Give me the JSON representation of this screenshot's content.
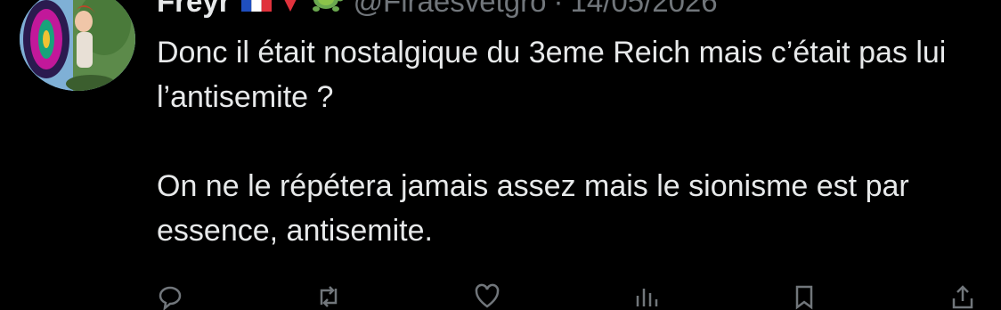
{
  "tweet": {
    "author": {
      "display_name": "Freyr",
      "flag_icon": "france-flag-icon",
      "pin_icon": "red-pin-icon",
      "turtle_icon": "turtle-emoji-icon",
      "handle": "@Firaesvetgro",
      "separator": "·",
      "date": "14/05/2026"
    },
    "text": {
      "paragraph_1": "Donc il était nostalgique du 3eme Reich mais c’était pas lui l’antisemite ?",
      "paragraph_2": "On ne le répétera jamais assez mais le sionisme est par essence, antisemite."
    },
    "actions": [
      {
        "icon": "reply-icon"
      },
      {
        "icon": "retweet-icon"
      },
      {
        "icon": "like-icon"
      },
      {
        "icon": "views-icon"
      },
      {
        "icon": "bookmark-icon"
      },
      {
        "icon": "share-icon"
      }
    ]
  },
  "colors": {
    "background": "#000000",
    "primary_text": "#e7e9ea",
    "secondary_text": "#71767b"
  }
}
